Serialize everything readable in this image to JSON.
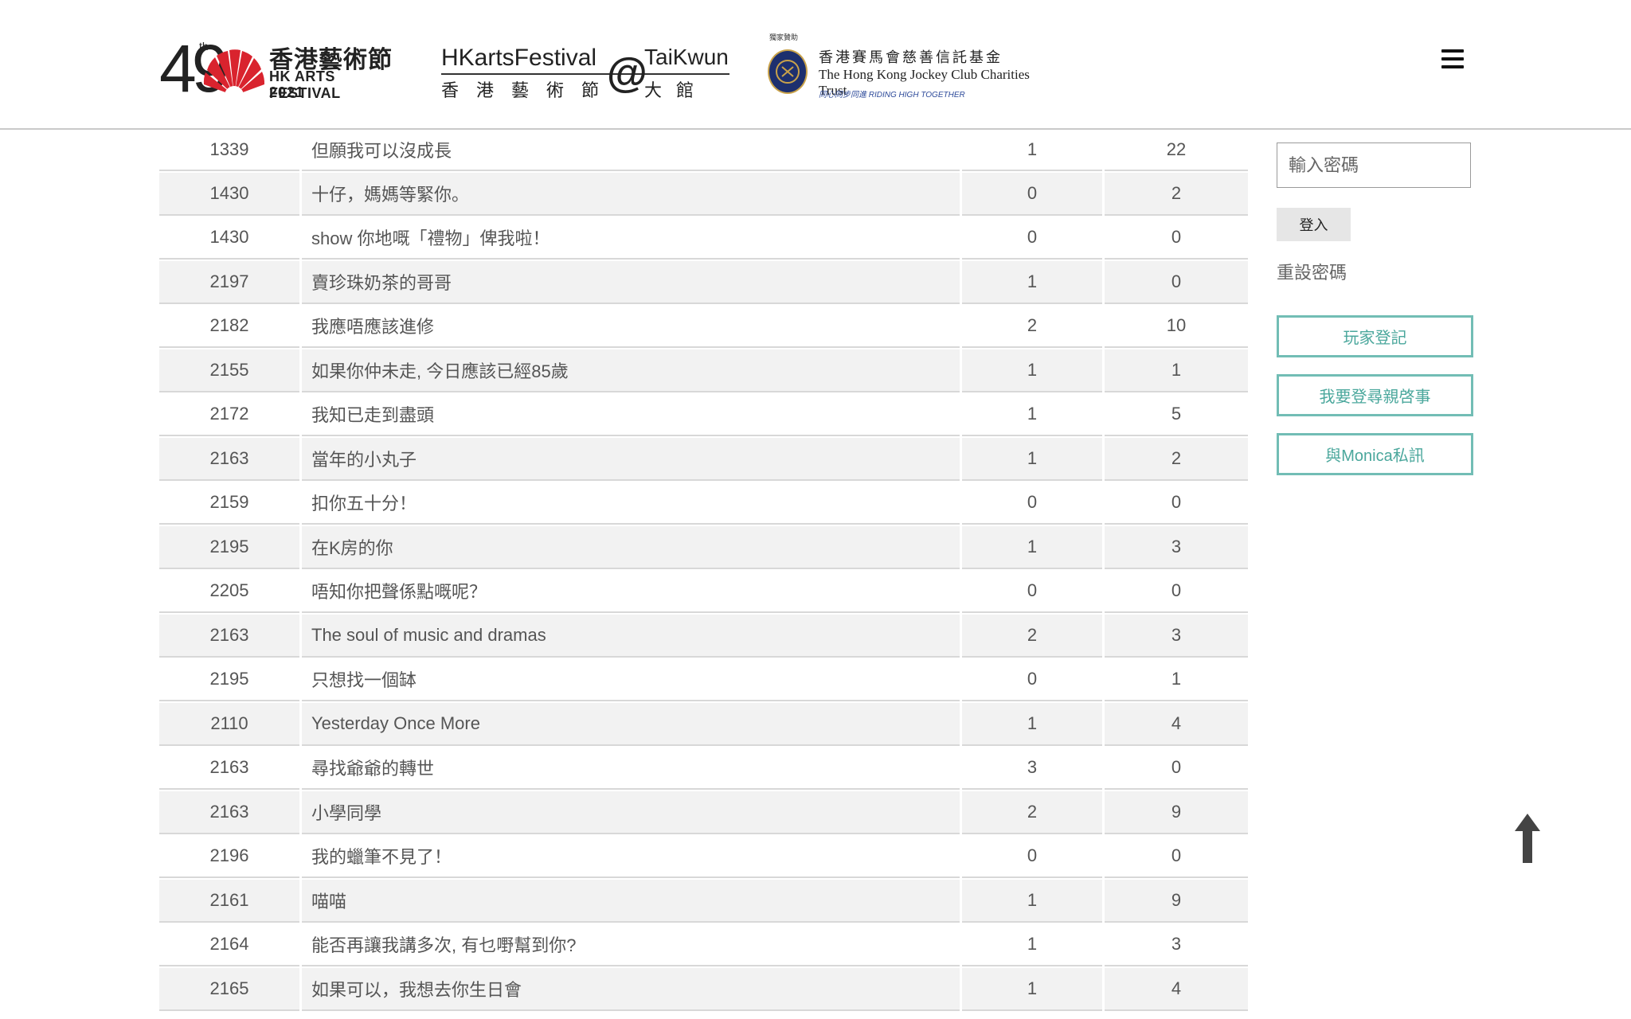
{
  "header": {
    "logo_hkaf": {
      "number": "49",
      "ordinal": "th",
      "name_zh": "香港藝術節",
      "name_en": "HK ARTS FESTIVAL",
      "year": "2021"
    },
    "logo_taikwun": {
      "left_top": "HKartsFestival",
      "at": "@",
      "right_top": "TaiKwun",
      "left_bottom": "香港藝術節",
      "right_bottom": "大館"
    },
    "logo_jockey": {
      "sponsor_label": "獨家贊助",
      "name_zh": "香港賽馬會慈善信託基金",
      "name_en": "The Hong Kong Jockey Club Charities Trust",
      "tagline": "同心同步同進 RIDING HIGH TOGETHER"
    },
    "colors": {
      "accent_red": "#d9232e",
      "teal": "#4aa79c"
    }
  },
  "table": {
    "rows": [
      {
        "id": "1339",
        "title": "但願我可以沒成長",
        "a": "1",
        "b": "22"
      },
      {
        "id": "1430",
        "title": "十仔，媽媽等緊你。",
        "a": "0",
        "b": "2"
      },
      {
        "id": "1430",
        "title": "show 你地嘅「禮物」俾我啦！",
        "a": "0",
        "b": "0"
      },
      {
        "id": "2197",
        "title": "賣珍珠奶茶的哥哥",
        "a": "1",
        "b": "0"
      },
      {
        "id": "2182",
        "title": "我應唔應該進修",
        "a": "2",
        "b": "10"
      },
      {
        "id": "2155",
        "title": "如果你仲未走, 今日應該已經85歲",
        "a": "1",
        "b": "1"
      },
      {
        "id": "2172",
        "title": "我知已走到盡頭",
        "a": "1",
        "b": "5"
      },
      {
        "id": "2163",
        "title": "當年的小丸子",
        "a": "1",
        "b": "2"
      },
      {
        "id": "2159",
        "title": "扣你五十分！",
        "a": "0",
        "b": "0"
      },
      {
        "id": "2195",
        "title": "在K房的你",
        "a": "1",
        "b": "3"
      },
      {
        "id": "2205",
        "title": "唔知你把聲係點嘅呢？",
        "a": "0",
        "b": "0"
      },
      {
        "id": "2163",
        "title": "The soul of music and dramas",
        "a": "2",
        "b": "3"
      },
      {
        "id": "2195",
        "title": "只想找一個缽",
        "a": "0",
        "b": "1"
      },
      {
        "id": "2110",
        "title": "Yesterday Once More",
        "a": "1",
        "b": "4"
      },
      {
        "id": "2163",
        "title": "尋找爺爺的轉世",
        "a": "3",
        "b": "0"
      },
      {
        "id": "2163",
        "title": "小學同學",
        "a": "2",
        "b": "9"
      },
      {
        "id": "2196",
        "title": "我的蠟筆不見了！",
        "a": "0",
        "b": "0"
      },
      {
        "id": "2161",
        "title": "喵喵",
        "a": "1",
        "b": "9"
      },
      {
        "id": "2164",
        "title": "能否再讓我講多次, 有乜嘢幫到你?",
        "a": "1",
        "b": "3"
      },
      {
        "id": "2165",
        "title": "如果可以，我想去你生日會",
        "a": "1",
        "b": "4"
      }
    ]
  },
  "sidebar": {
    "password_placeholder": "輸入密碼",
    "login_label": "登入",
    "reset_label": "重設密碼",
    "register_label": "玩家登記",
    "find_relative_label": "我要登尋親啓事",
    "monica_label": "與Monica私訊"
  },
  "icons": {
    "menu": "hamburger-icon",
    "back_to_top": "arrow-up-icon"
  }
}
